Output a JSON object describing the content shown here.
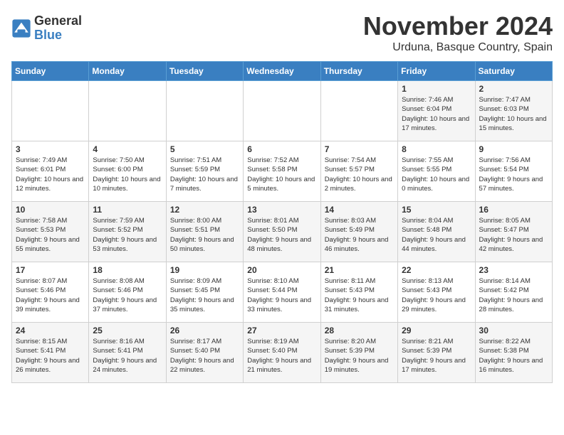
{
  "logo": {
    "general": "General",
    "blue": "Blue"
  },
  "title": "November 2024",
  "location": "Urduna, Basque Country, Spain",
  "headers": [
    "Sunday",
    "Monday",
    "Tuesday",
    "Wednesday",
    "Thursday",
    "Friday",
    "Saturday"
  ],
  "weeks": [
    [
      {
        "day": "",
        "info": ""
      },
      {
        "day": "",
        "info": ""
      },
      {
        "day": "",
        "info": ""
      },
      {
        "day": "",
        "info": ""
      },
      {
        "day": "",
        "info": ""
      },
      {
        "day": "1",
        "info": "Sunrise: 7:46 AM\nSunset: 6:04 PM\nDaylight: 10 hours and 17 minutes."
      },
      {
        "day": "2",
        "info": "Sunrise: 7:47 AM\nSunset: 6:03 PM\nDaylight: 10 hours and 15 minutes."
      }
    ],
    [
      {
        "day": "3",
        "info": "Sunrise: 7:49 AM\nSunset: 6:01 PM\nDaylight: 10 hours and 12 minutes."
      },
      {
        "day": "4",
        "info": "Sunrise: 7:50 AM\nSunset: 6:00 PM\nDaylight: 10 hours and 10 minutes."
      },
      {
        "day": "5",
        "info": "Sunrise: 7:51 AM\nSunset: 5:59 PM\nDaylight: 10 hours and 7 minutes."
      },
      {
        "day": "6",
        "info": "Sunrise: 7:52 AM\nSunset: 5:58 PM\nDaylight: 10 hours and 5 minutes."
      },
      {
        "day": "7",
        "info": "Sunrise: 7:54 AM\nSunset: 5:57 PM\nDaylight: 10 hours and 2 minutes."
      },
      {
        "day": "8",
        "info": "Sunrise: 7:55 AM\nSunset: 5:55 PM\nDaylight: 10 hours and 0 minutes."
      },
      {
        "day": "9",
        "info": "Sunrise: 7:56 AM\nSunset: 5:54 PM\nDaylight: 9 hours and 57 minutes."
      }
    ],
    [
      {
        "day": "10",
        "info": "Sunrise: 7:58 AM\nSunset: 5:53 PM\nDaylight: 9 hours and 55 minutes."
      },
      {
        "day": "11",
        "info": "Sunrise: 7:59 AM\nSunset: 5:52 PM\nDaylight: 9 hours and 53 minutes."
      },
      {
        "day": "12",
        "info": "Sunrise: 8:00 AM\nSunset: 5:51 PM\nDaylight: 9 hours and 50 minutes."
      },
      {
        "day": "13",
        "info": "Sunrise: 8:01 AM\nSunset: 5:50 PM\nDaylight: 9 hours and 48 minutes."
      },
      {
        "day": "14",
        "info": "Sunrise: 8:03 AM\nSunset: 5:49 PM\nDaylight: 9 hours and 46 minutes."
      },
      {
        "day": "15",
        "info": "Sunrise: 8:04 AM\nSunset: 5:48 PM\nDaylight: 9 hours and 44 minutes."
      },
      {
        "day": "16",
        "info": "Sunrise: 8:05 AM\nSunset: 5:47 PM\nDaylight: 9 hours and 42 minutes."
      }
    ],
    [
      {
        "day": "17",
        "info": "Sunrise: 8:07 AM\nSunset: 5:46 PM\nDaylight: 9 hours and 39 minutes."
      },
      {
        "day": "18",
        "info": "Sunrise: 8:08 AM\nSunset: 5:46 PM\nDaylight: 9 hours and 37 minutes."
      },
      {
        "day": "19",
        "info": "Sunrise: 8:09 AM\nSunset: 5:45 PM\nDaylight: 9 hours and 35 minutes."
      },
      {
        "day": "20",
        "info": "Sunrise: 8:10 AM\nSunset: 5:44 PM\nDaylight: 9 hours and 33 minutes."
      },
      {
        "day": "21",
        "info": "Sunrise: 8:11 AM\nSunset: 5:43 PM\nDaylight: 9 hours and 31 minutes."
      },
      {
        "day": "22",
        "info": "Sunrise: 8:13 AM\nSunset: 5:43 PM\nDaylight: 9 hours and 29 minutes."
      },
      {
        "day": "23",
        "info": "Sunrise: 8:14 AM\nSunset: 5:42 PM\nDaylight: 9 hours and 28 minutes."
      }
    ],
    [
      {
        "day": "24",
        "info": "Sunrise: 8:15 AM\nSunset: 5:41 PM\nDaylight: 9 hours and 26 minutes."
      },
      {
        "day": "25",
        "info": "Sunrise: 8:16 AM\nSunset: 5:41 PM\nDaylight: 9 hours and 24 minutes."
      },
      {
        "day": "26",
        "info": "Sunrise: 8:17 AM\nSunset: 5:40 PM\nDaylight: 9 hours and 22 minutes."
      },
      {
        "day": "27",
        "info": "Sunrise: 8:19 AM\nSunset: 5:40 PM\nDaylight: 9 hours and 21 minutes."
      },
      {
        "day": "28",
        "info": "Sunrise: 8:20 AM\nSunset: 5:39 PM\nDaylight: 9 hours and 19 minutes."
      },
      {
        "day": "29",
        "info": "Sunrise: 8:21 AM\nSunset: 5:39 PM\nDaylight: 9 hours and 17 minutes."
      },
      {
        "day": "30",
        "info": "Sunrise: 8:22 AM\nSunset: 5:38 PM\nDaylight: 9 hours and 16 minutes."
      }
    ]
  ]
}
